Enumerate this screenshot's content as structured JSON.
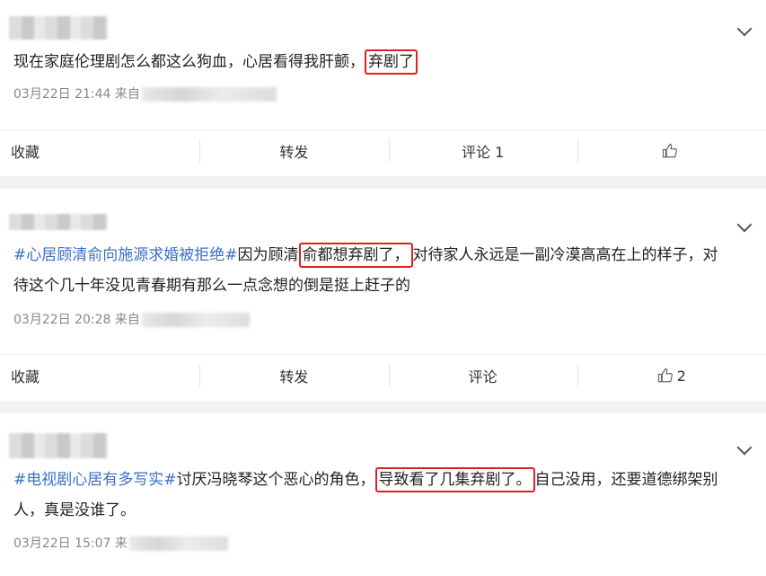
{
  "posts": [
    {
      "text_plain": "现在家庭伦理剧怎么都这么狗血，心居看得我肝颤，",
      "highlight": "弃剧了",
      "date": "03月22日 21:44",
      "source_prefix": "来自",
      "actions": {
        "fav": "收藏",
        "repost": "转发",
        "comment": "评论 1",
        "like_count": ""
      }
    },
    {
      "tag": "#心居顾清俞向施源求婚被拒绝#",
      "text_before": "因为顾清",
      "highlight": "俞都想弃剧了，",
      "text_after": "对待家人永远是一副冷漠高高在上的样子，对待这个几十年没见青春期有那么一点念想的倒是挺上赶子的",
      "date": "03月22日 20:28",
      "source_prefix": "来自",
      "actions": {
        "fav": "收藏",
        "repost": "转发",
        "comment": "评论",
        "like_count": "2"
      }
    },
    {
      "tag": "#电视剧心居有多写实#",
      "text_before": "讨厌冯晓琴这个恶心的角色，",
      "highlight": "导致看了几集弃剧了。",
      "text_after": "自己没用，还要道德绑架别人，真是没谁了。",
      "date": "03月22日 15:07",
      "source_prefix": "来"
    }
  ],
  "colors": {
    "tag": "#3b70c4",
    "highlight_border": "#e02020"
  },
  "icons": {
    "menu": "chevron-down-icon",
    "like": "thumbs-up-icon"
  }
}
